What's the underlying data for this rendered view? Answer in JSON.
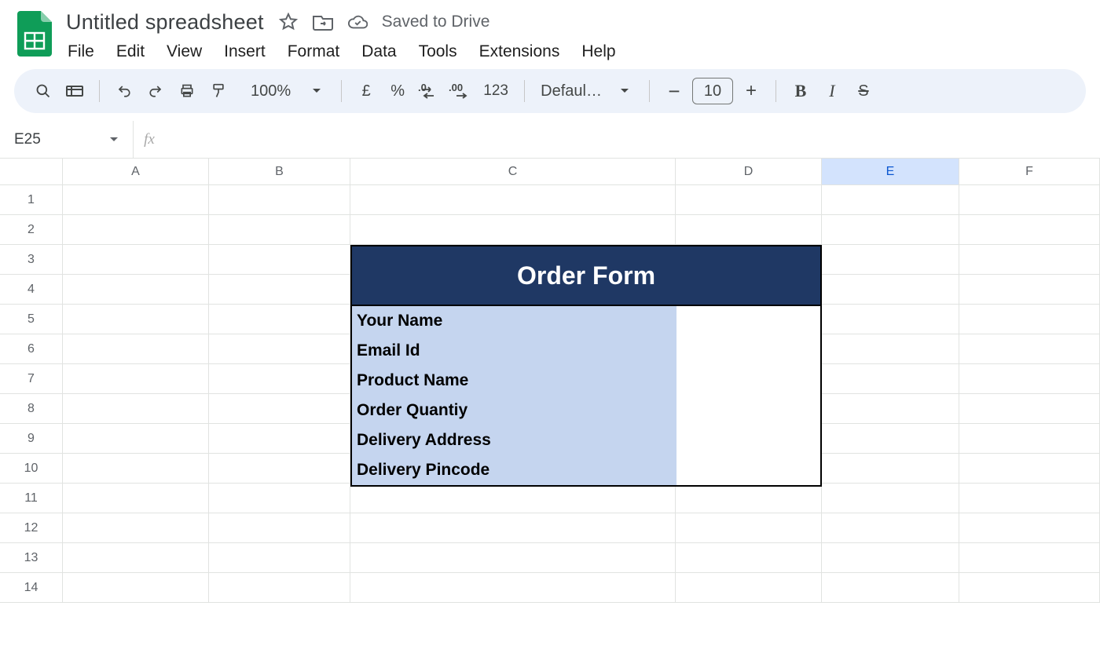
{
  "doc": {
    "title": "Untitled spreadsheet",
    "saved_status": "Saved to Drive"
  },
  "menu": {
    "items": [
      "File",
      "Edit",
      "View",
      "Insert",
      "Format",
      "Data",
      "Tools",
      "Extensions",
      "Help"
    ]
  },
  "toolbar": {
    "zoom": "100%",
    "currency_symbol": "£",
    "percent_symbol": "%",
    "number_format": "123",
    "font_name": "Defaul…",
    "font_size": "10"
  },
  "namebox": {
    "cell_ref": "E25",
    "fx_label": "fx"
  },
  "grid": {
    "columns": [
      "A",
      "B",
      "C",
      "D",
      "E",
      "F"
    ],
    "selected_column": "E",
    "rows": [
      "1",
      "2",
      "3",
      "4",
      "5",
      "6",
      "7",
      "8",
      "9",
      "10",
      "11",
      "12",
      "13",
      "14"
    ]
  },
  "order_form": {
    "title": "Order Form",
    "fields": [
      "Your Name",
      "Email Id",
      "Product Name",
      "Order Quantiy",
      "Delivery Address",
      "Delivery Pincode"
    ]
  },
  "colors": {
    "form_header_bg": "#1f3864",
    "form_label_bg": "#c5d5ef",
    "toolbar_bg": "#edf2fa"
  }
}
